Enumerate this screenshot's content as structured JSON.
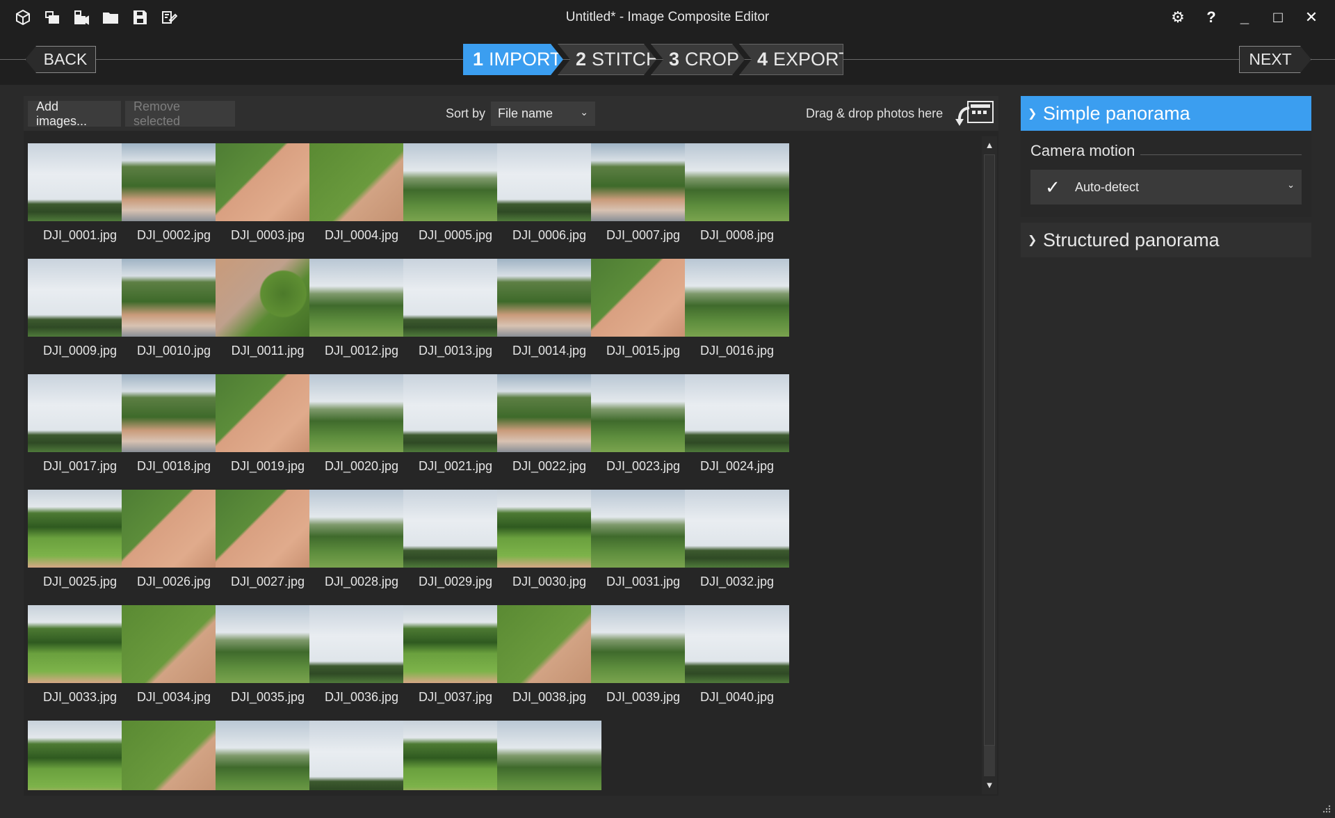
{
  "window": {
    "title": "Untitled* - Image Composite Editor",
    "toolbar_icons": [
      "new-project-icon",
      "new-panorama-from-images-icon",
      "new-panorama-from-video-icon",
      "open-project-icon",
      "save-icon",
      "publish-icon"
    ],
    "controls": {
      "settings": "⚙",
      "help": "?",
      "minimize": "_",
      "maximize": "□",
      "close": "✕"
    }
  },
  "nav": {
    "back_label": "BACK",
    "next_label": "NEXT",
    "steps": [
      {
        "num": "1",
        "label": "IMPORT",
        "active": true
      },
      {
        "num": "2",
        "label": "STITCH",
        "active": false
      },
      {
        "num": "3",
        "label": "CROP",
        "active": false
      },
      {
        "num": "4",
        "label": "EXPORT",
        "active": false
      }
    ]
  },
  "toolbar": {
    "add_label": "Add images...",
    "remove_label": "Remove selected",
    "sort_label": "Sort by",
    "sort_value": "File name",
    "drop_label": "Drag & drop photos here"
  },
  "images": [
    {
      "name": "DJI_0001.jpg",
      "scene": "sky"
    },
    {
      "name": "DJI_0002.jpg",
      "scene": "chateau"
    },
    {
      "name": "DJI_0003.jpg",
      "scene": "topdown"
    },
    {
      "name": "DJI_0004.jpg",
      "scene": "lawn"
    },
    {
      "name": "DJI_0005.jpg",
      "scene": "horizon"
    },
    {
      "name": "DJI_0006.jpg",
      "scene": "sky"
    },
    {
      "name": "DJI_0007.jpg",
      "scene": "chateau"
    },
    {
      "name": "DJI_0008.jpg",
      "scene": "horizon"
    },
    {
      "name": "DJI_0009.jpg",
      "scene": "sky"
    },
    {
      "name": "DJI_0010.jpg",
      "scene": "chateau"
    },
    {
      "name": "DJI_0011.jpg",
      "scene": "tree"
    },
    {
      "name": "DJI_0012.jpg",
      "scene": "horizon"
    },
    {
      "name": "DJI_0013.jpg",
      "scene": "sky"
    },
    {
      "name": "DJI_0014.jpg",
      "scene": "chateau"
    },
    {
      "name": "DJI_0015.jpg",
      "scene": "topdown"
    },
    {
      "name": "DJI_0016.jpg",
      "scene": "horizon"
    },
    {
      "name": "DJI_0017.jpg",
      "scene": "sky"
    },
    {
      "name": "DJI_0018.jpg",
      "scene": "chateau"
    },
    {
      "name": "DJI_0019.jpg",
      "scene": "topdown"
    },
    {
      "name": "DJI_0020.jpg",
      "scene": "horizon"
    },
    {
      "name": "DJI_0021.jpg",
      "scene": "sky"
    },
    {
      "name": "DJI_0022.jpg",
      "scene": "chateau"
    },
    {
      "name": "DJI_0023.jpg",
      "scene": "horizon"
    },
    {
      "name": "DJI_0024.jpg",
      "scene": "sky"
    },
    {
      "name": "DJI_0025.jpg",
      "scene": "field"
    },
    {
      "name": "DJI_0026.jpg",
      "scene": "topdown"
    },
    {
      "name": "DJI_0027.jpg",
      "scene": "topdown"
    },
    {
      "name": "DJI_0028.jpg",
      "scene": "horizon"
    },
    {
      "name": "DJI_0029.jpg",
      "scene": "sky"
    },
    {
      "name": "DJI_0030.jpg",
      "scene": "field"
    },
    {
      "name": "DJI_0031.jpg",
      "scene": "horizon"
    },
    {
      "name": "DJI_0032.jpg",
      "scene": "sky"
    },
    {
      "name": "DJI_0033.jpg",
      "scene": "field"
    },
    {
      "name": "DJI_0034.jpg",
      "scene": "lawn"
    },
    {
      "name": "DJI_0035.jpg",
      "scene": "horizon"
    },
    {
      "name": "DJI_0036.jpg",
      "scene": "sky"
    },
    {
      "name": "DJI_0037.jpg",
      "scene": "field"
    },
    {
      "name": "DJI_0038.jpg",
      "scene": "lawn"
    },
    {
      "name": "DJI_0039.jpg",
      "scene": "horizon"
    },
    {
      "name": "DJI_0040.jpg",
      "scene": "sky"
    },
    {
      "name": "",
      "scene": "field"
    },
    {
      "name": "",
      "scene": "lawn"
    },
    {
      "name": "",
      "scene": "horizon"
    },
    {
      "name": "",
      "scene": "sky"
    },
    {
      "name": "",
      "scene": "field"
    },
    {
      "name": "",
      "scene": "horizon"
    }
  ],
  "panel": {
    "simple_title": "Simple panorama",
    "camera_motion_label": "Camera motion",
    "camera_motion_value": "Auto-detect",
    "structured_title": "Structured panorama"
  },
  "colors": {
    "accent": "#3b9ef0",
    "background": "#262626",
    "titlebar": "#1f1f1f"
  }
}
